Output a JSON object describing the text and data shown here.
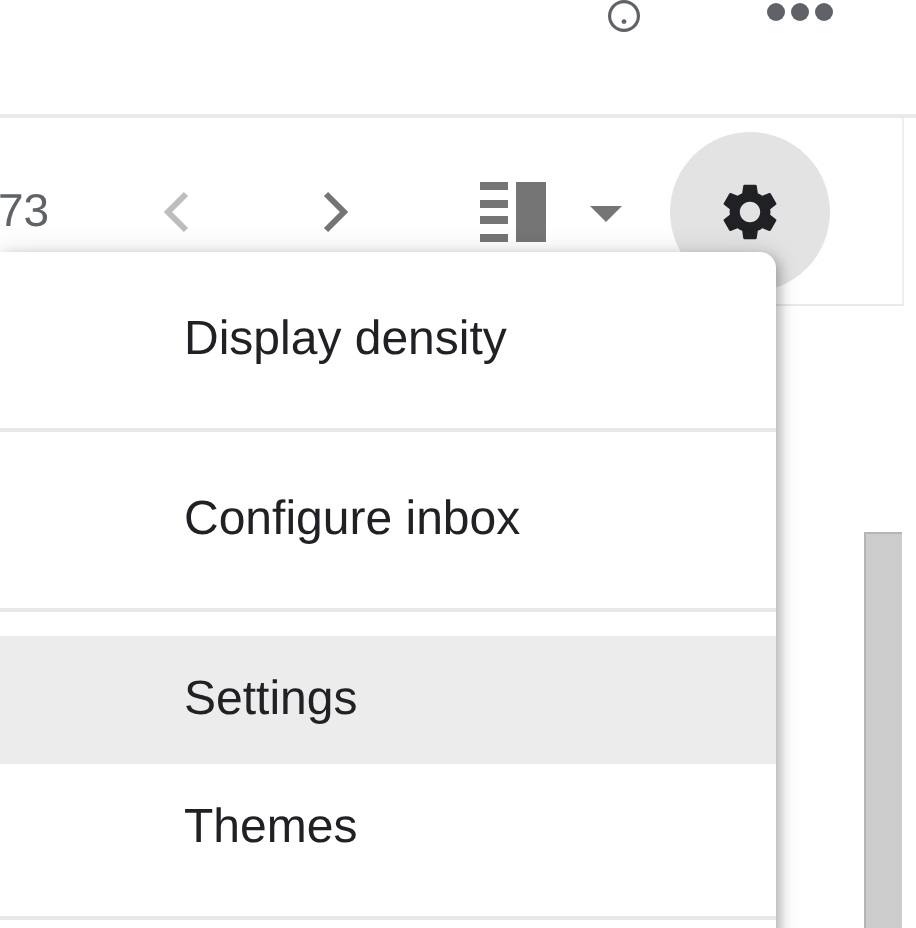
{
  "toolbar": {
    "count": "73",
    "settings_open": true
  },
  "menu": {
    "sections": [
      {
        "items": [
          {
            "label": "Display density",
            "selected": false
          }
        ]
      },
      {
        "items": [
          {
            "label": "Configure inbox",
            "selected": false
          }
        ]
      },
      {
        "items": [
          {
            "label": "Settings",
            "selected": true
          },
          {
            "label": "Themes",
            "selected": false
          }
        ]
      }
    ]
  }
}
